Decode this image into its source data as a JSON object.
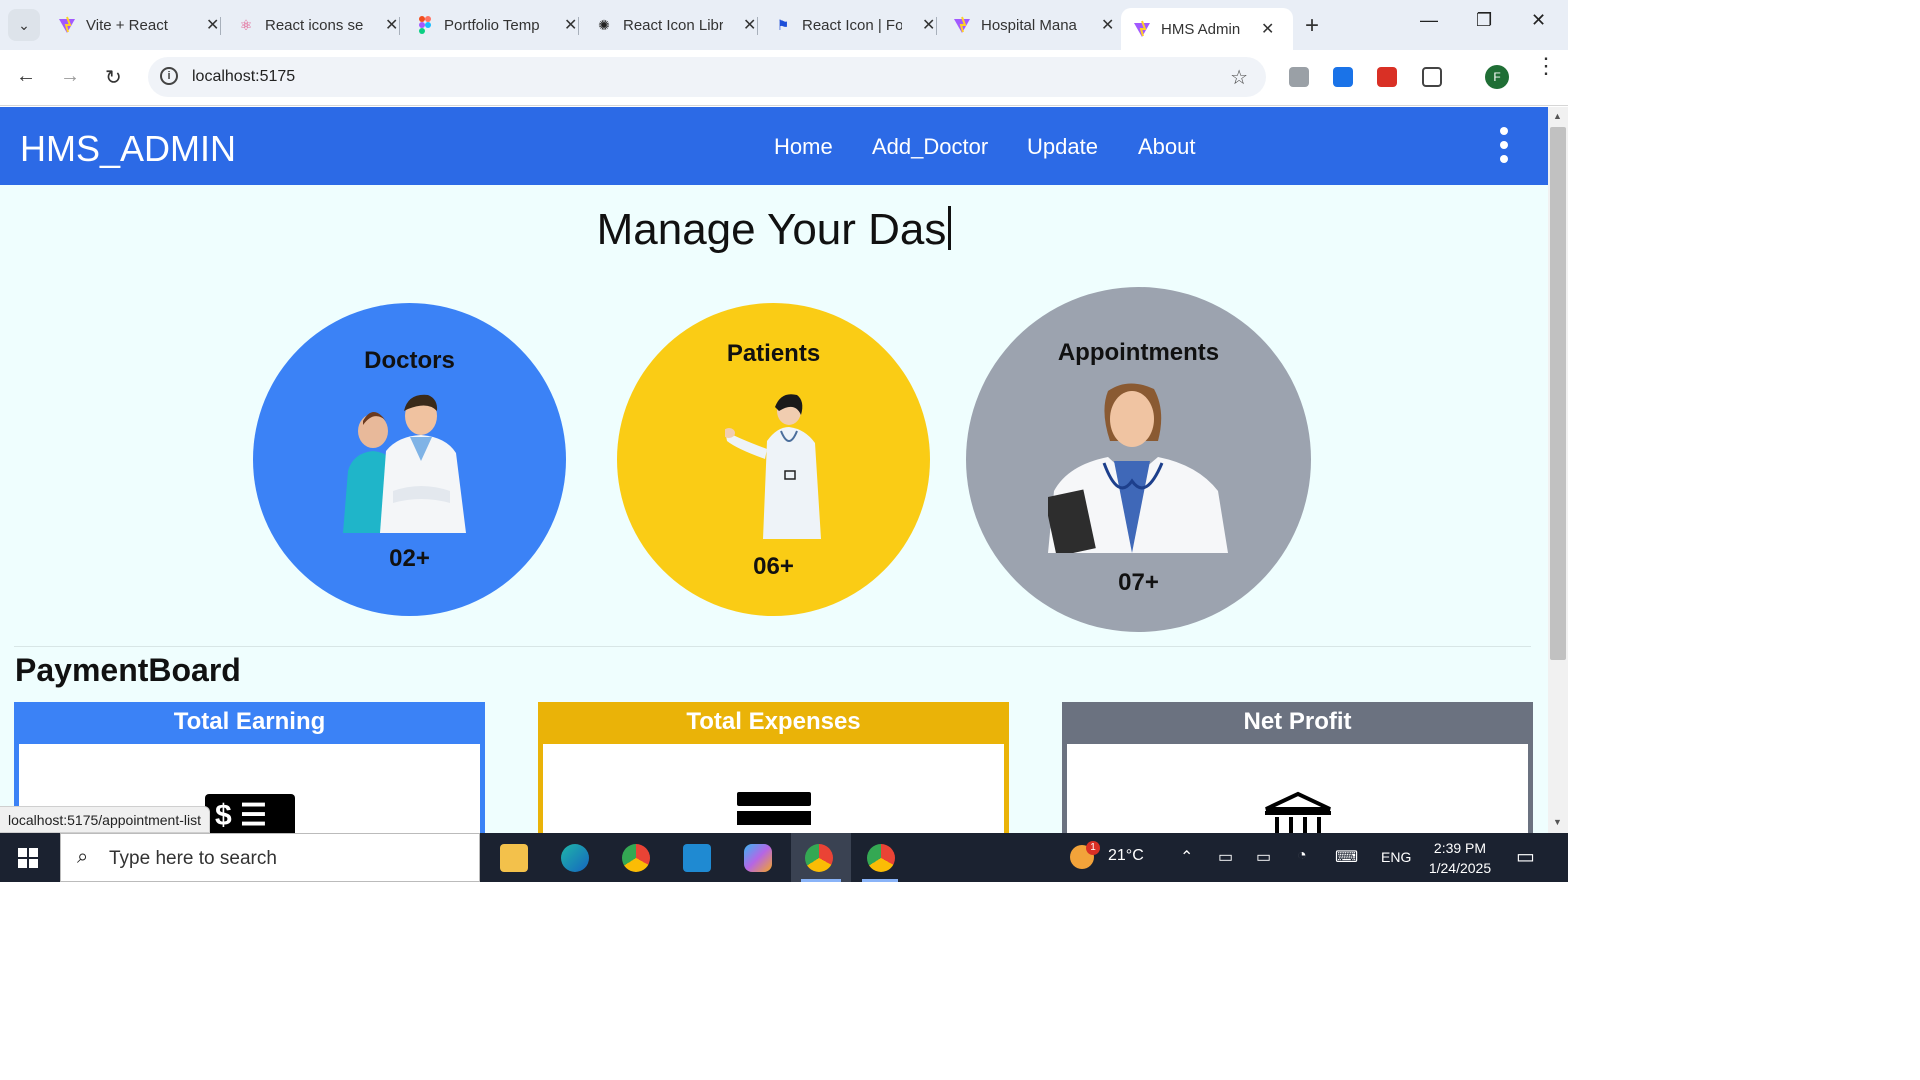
{
  "browser": {
    "tabs": [
      {
        "title": "Vite + React",
        "icon": "vite-icon",
        "color": "#a259ff"
      },
      {
        "title": "React icons se",
        "icon": "react-icon",
        "color": "#e0407b"
      },
      {
        "title": "Portfolio Temp",
        "icon": "figma-icon",
        "color": "#f24e1e"
      },
      {
        "title": "React Icon Libr",
        "icon": "openai-icon",
        "color": "#222222"
      },
      {
        "title": "React Icon | Fo",
        "icon": "flag-icon",
        "color": "#1d4ed8"
      },
      {
        "title": "Hospital Mana",
        "icon": "vite-icon",
        "color": "#a259ff"
      },
      {
        "title": "HMS Admin",
        "icon": "vite-icon",
        "color": "#a259ff"
      }
    ],
    "url": "localhost:5175",
    "status_url": "localhost:5175/appointment-list",
    "profile_initial": "F"
  },
  "app": {
    "brand": "HMS_ADMIN",
    "nav": [
      "Home",
      "Add_Doctor",
      "Update",
      "About"
    ],
    "headline": "Manage Your Das",
    "stats": [
      {
        "label": "Doctors",
        "count": "02+",
        "color": "#3b82f6"
      },
      {
        "label": "Patients",
        "count": "06+",
        "color": "#facc15"
      },
      {
        "label": "Appointments",
        "count": "07+",
        "color": "#9ca3af"
      }
    ],
    "payment_board": {
      "title": "PaymentBoard",
      "cards": [
        {
          "title": "Total Earning",
          "color": "#3b82f6",
          "icon": "money-icon"
        },
        {
          "title": "Total Expenses",
          "color": "#eab308",
          "icon": "receipt-icon"
        },
        {
          "title": "Net Profit",
          "color": "#6b7280",
          "icon": "bank-icon"
        }
      ]
    }
  },
  "taskbar": {
    "search_placeholder": "Type here to search",
    "weather": "21°C",
    "weather_badge": "1",
    "language": "ENG",
    "time": "2:39 PM",
    "date": "1/24/2025"
  }
}
